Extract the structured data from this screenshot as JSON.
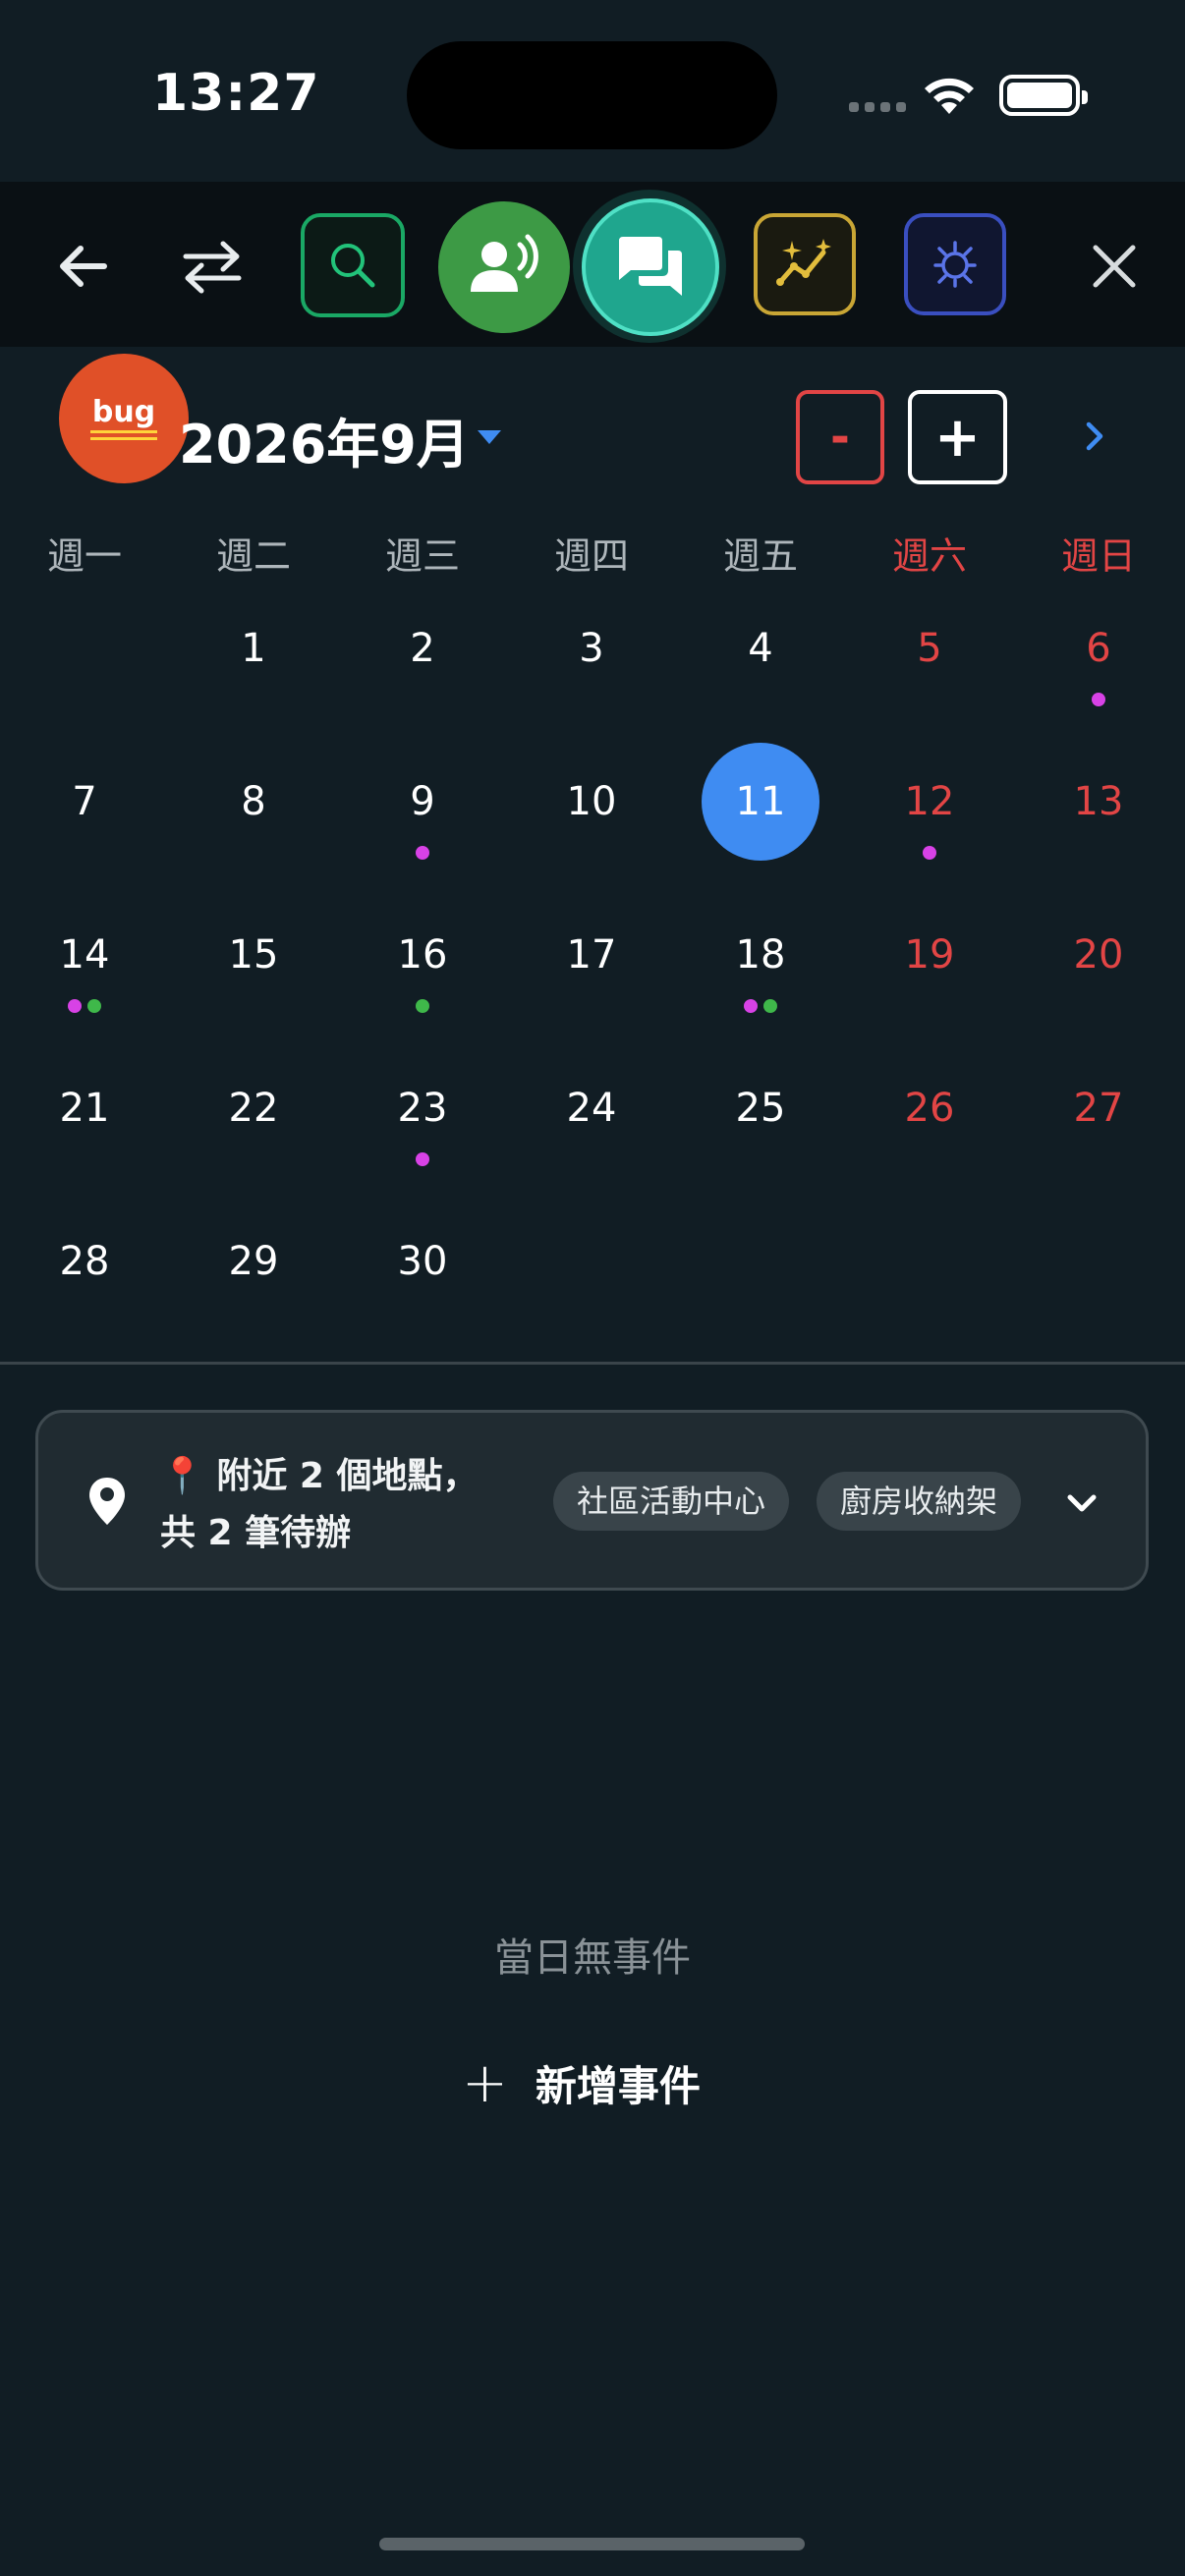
{
  "status_bar": {
    "time": "13:27"
  },
  "toolbar": {
    "buttons": [
      {
        "name": "back",
        "icon": "arrow-left-icon"
      },
      {
        "name": "swap",
        "icon": "swap-arrows-icon"
      },
      {
        "name": "search",
        "icon": "search-icon"
      },
      {
        "name": "voice",
        "icon": "voice-user-icon"
      },
      {
        "name": "chat",
        "icon": "chat-icon",
        "active": true
      },
      {
        "name": "trend",
        "icon": "sparkle-trend-icon"
      },
      {
        "name": "debug",
        "icon": "bug-icon"
      },
      {
        "name": "close",
        "icon": "close-icon"
      }
    ],
    "colors": {
      "search": "#1aa865",
      "voice": "#3d9a45",
      "chat": "#1fa68e",
      "trend": "#c9a635",
      "debug": "#3a4fc0"
    }
  },
  "header": {
    "badge_label": "bug",
    "month_title": "2026年9月",
    "minus_label": "-",
    "plus_label": "+"
  },
  "calendar": {
    "weekdays": [
      "週一",
      "週二",
      "週三",
      "週四",
      "週五",
      "週六",
      "週日"
    ],
    "selected_day": 11,
    "days": [
      {
        "d": "1",
        "col": 1,
        "row": 0,
        "dots": []
      },
      {
        "d": "2",
        "col": 2,
        "row": 0,
        "dots": []
      },
      {
        "d": "3",
        "col": 3,
        "row": 0,
        "dots": []
      },
      {
        "d": "4",
        "col": 4,
        "row": 0,
        "dots": []
      },
      {
        "d": "5",
        "col": 5,
        "row": 0,
        "dots": []
      },
      {
        "d": "6",
        "col": 6,
        "row": 0,
        "dots": [
          "magenta"
        ]
      },
      {
        "d": "7",
        "col": 0,
        "row": 1,
        "dots": []
      },
      {
        "d": "8",
        "col": 1,
        "row": 1,
        "dots": []
      },
      {
        "d": "9",
        "col": 2,
        "row": 1,
        "dots": [
          "magenta"
        ]
      },
      {
        "d": "10",
        "col": 3,
        "row": 1,
        "dots": []
      },
      {
        "d": "11",
        "col": 4,
        "row": 1,
        "dots": []
      },
      {
        "d": "12",
        "col": 5,
        "row": 1,
        "dots": [
          "magenta"
        ]
      },
      {
        "d": "13",
        "col": 6,
        "row": 1,
        "dots": []
      },
      {
        "d": "14",
        "col": 0,
        "row": 2,
        "dots": [
          "magenta",
          "green"
        ]
      },
      {
        "d": "15",
        "col": 1,
        "row": 2,
        "dots": []
      },
      {
        "d": "16",
        "col": 2,
        "row": 2,
        "dots": [
          "green"
        ]
      },
      {
        "d": "17",
        "col": 3,
        "row": 2,
        "dots": []
      },
      {
        "d": "18",
        "col": 4,
        "row": 2,
        "dots": [
          "magenta",
          "green"
        ]
      },
      {
        "d": "19",
        "col": 5,
        "row": 2,
        "dots": []
      },
      {
        "d": "20",
        "col": 6,
        "row": 2,
        "dots": []
      },
      {
        "d": "21",
        "col": 0,
        "row": 3,
        "dots": []
      },
      {
        "d": "22",
        "col": 1,
        "row": 3,
        "dots": []
      },
      {
        "d": "23",
        "col": 2,
        "row": 3,
        "dots": [
          "magenta"
        ]
      },
      {
        "d": "24",
        "col": 3,
        "row": 3,
        "dots": []
      },
      {
        "d": "25",
        "col": 4,
        "row": 3,
        "dots": []
      },
      {
        "d": "26",
        "col": 5,
        "row": 3,
        "dots": []
      },
      {
        "d": "27",
        "col": 6,
        "row": 3,
        "dots": []
      },
      {
        "d": "28",
        "col": 0,
        "row": 4,
        "dots": []
      },
      {
        "d": "29",
        "col": 1,
        "row": 4,
        "dots": []
      },
      {
        "d": "30",
        "col": 2,
        "row": 4,
        "dots": []
      }
    ],
    "colors": {
      "weekend": "#e24545",
      "selected": "#3f8cf2",
      "dot_magenta": "#d842e6",
      "dot_green": "#3fb84a"
    }
  },
  "location_card": {
    "emoji": "📍",
    "line1": "附近 2 個地點，",
    "line2": "共 2 筆待辦",
    "chips": [
      "社區活動中心",
      "廚房收納架"
    ]
  },
  "empty_state": {
    "message": "當日無事件",
    "add_plus": "+",
    "add_label": "新增事件"
  }
}
